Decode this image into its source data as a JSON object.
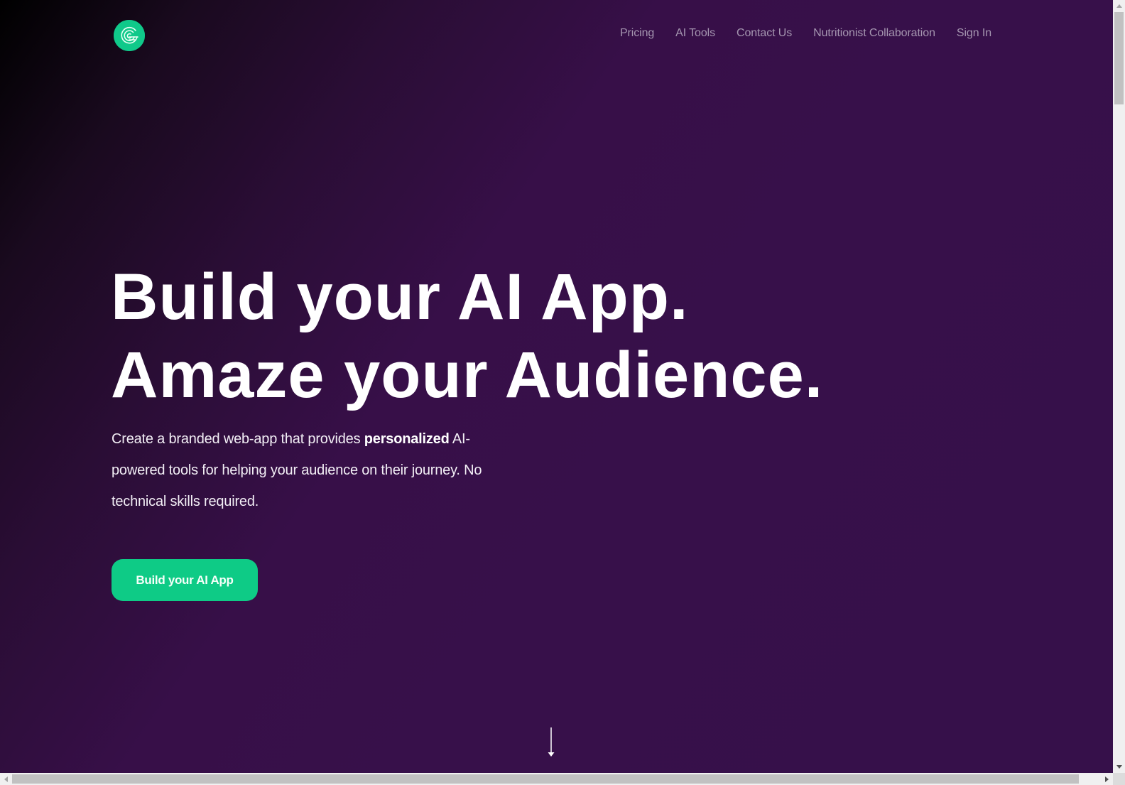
{
  "nav": {
    "logo_icon": "concentric-swirl-logo",
    "links": [
      {
        "label": "Pricing"
      },
      {
        "label": "AI Tools"
      },
      {
        "label": "Contact Us"
      },
      {
        "label": "Nutritionist Collaboration"
      },
      {
        "label": "Sign In"
      }
    ]
  },
  "hero": {
    "title_line1": "Build your AI App.",
    "title_line2": "Amaze your Audience.",
    "subtitle_before": "Create a branded web-app that provides ",
    "subtitle_bold": "personalized",
    "subtitle_after": " AI-powered tools for helping your audience on their journey. No technical skills required.",
    "cta_label": "Build your AI App",
    "scroll_icon": "arrow-down-icon"
  },
  "colors": {
    "accent": "#0ecb86",
    "background_dark": "#000000",
    "background_purple": "#37104a",
    "nav_text": "#a596b0"
  }
}
